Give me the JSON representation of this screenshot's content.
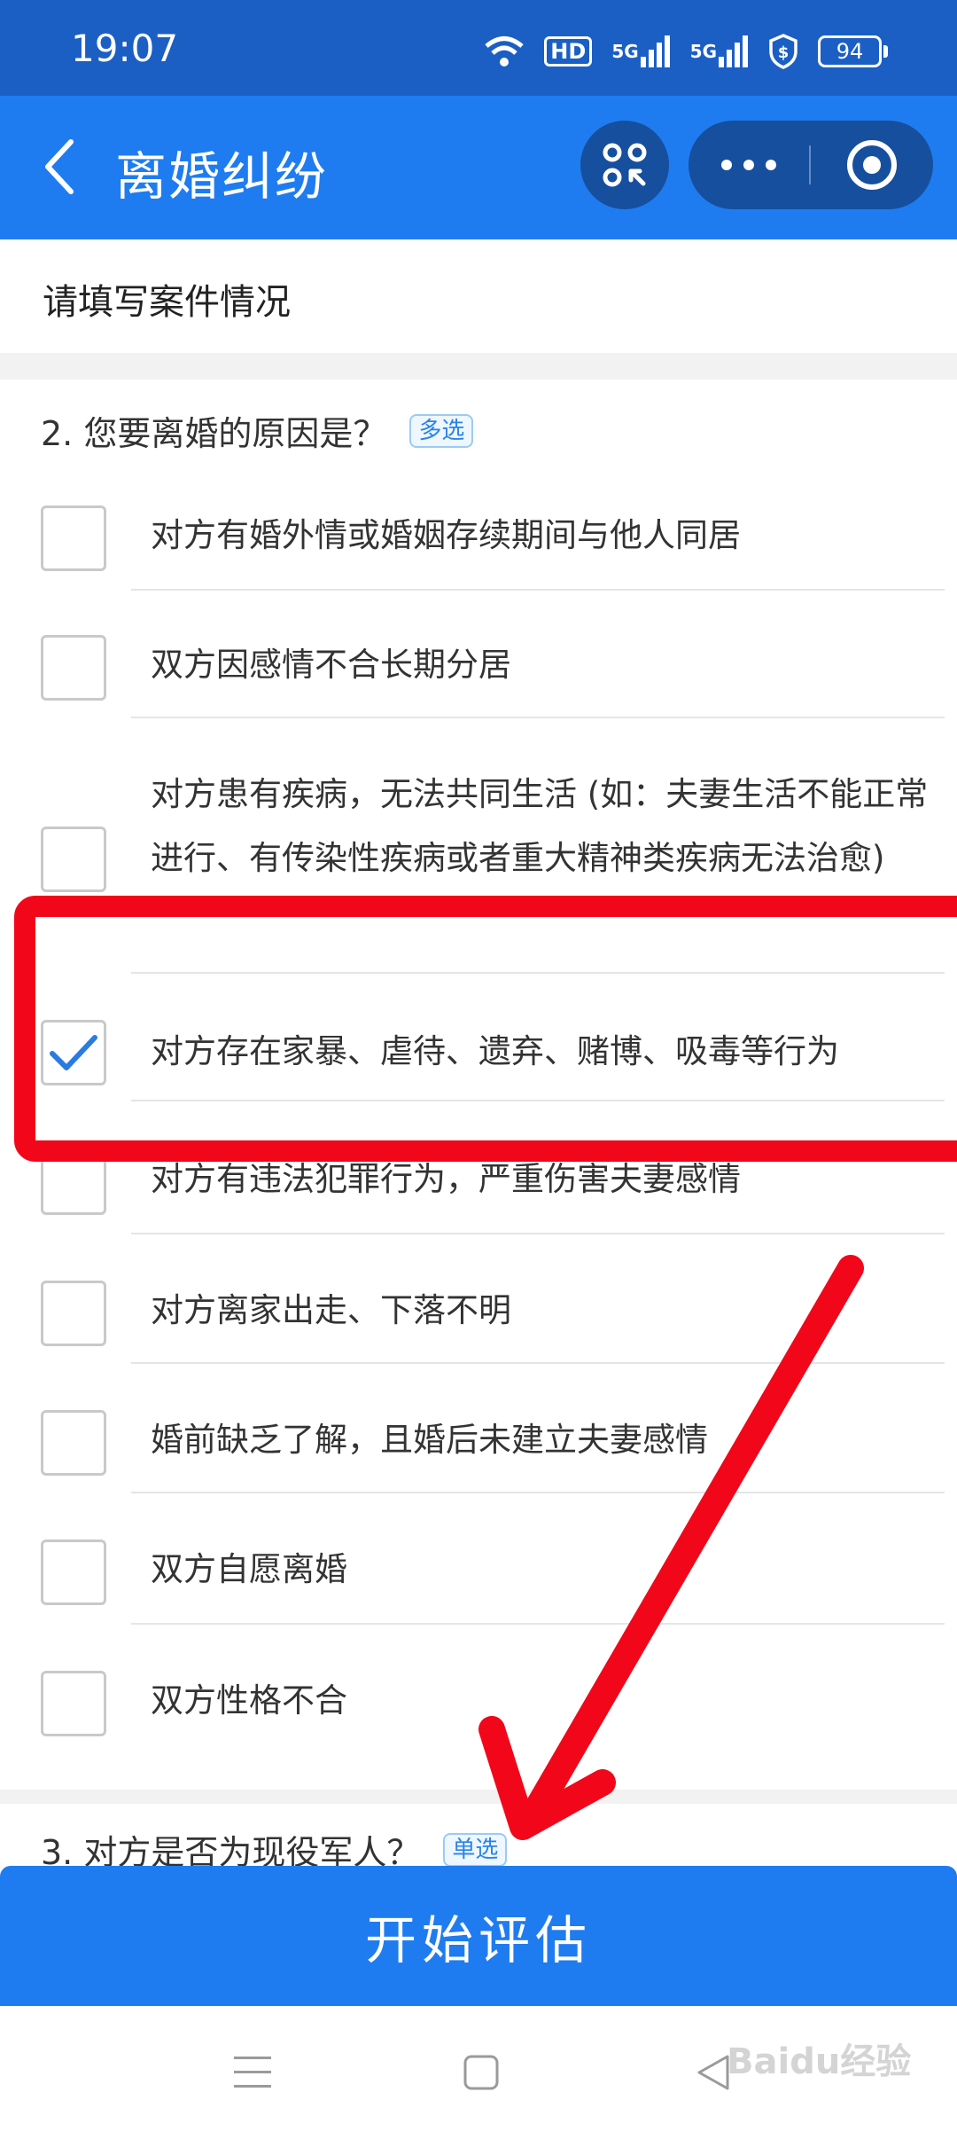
{
  "status_bar": {
    "time": "19:07",
    "hd_label": "HD",
    "signal1": "5G",
    "signal2": "5G",
    "battery": "94"
  },
  "navbar": {
    "title": "离婚纠纷"
  },
  "section": {
    "title": "请填写案件情况"
  },
  "question2": {
    "title": "2. 您要离婚的原因是？",
    "tag": "多选",
    "options": [
      {
        "label": "对方有婚外情或婚姻存续期间与他人同居",
        "checked": false
      },
      {
        "label": "双方因感情不合长期分居",
        "checked": false
      },
      {
        "label": "对方患有疾病，无法共同生活 (如：夫妻生活不能正常进行、有传染性疾病或者重大精神类疾病无法治愈)",
        "checked": false
      },
      {
        "label": "对方存在家暴、虐待、遗弃、赌博、吸毒等行为",
        "checked": true
      },
      {
        "label": "对方有违法犯罪行为，严重伤害夫妻感情",
        "checked": false
      },
      {
        "label": "对方离家出走、下落不明",
        "checked": false
      },
      {
        "label": "婚前缺乏了解，且婚后未建立夫妻感情",
        "checked": false
      },
      {
        "label": "双方自愿离婚",
        "checked": false
      },
      {
        "label": "双方性格不合",
        "checked": false
      }
    ]
  },
  "question3": {
    "title": "3. 对方是否为现役军人？",
    "tag": "单选"
  },
  "actions": {
    "start_label": "开始评估"
  },
  "watermark": {
    "text": "Baidu经验"
  },
  "colors": {
    "status_bar": "#1b5fc5",
    "navbar": "#1f7cf0",
    "button": "#1f7cf0",
    "annotation": "#f2061a",
    "check": "#2a7ae2"
  }
}
